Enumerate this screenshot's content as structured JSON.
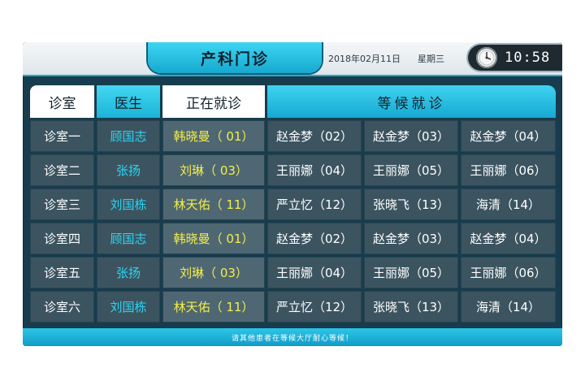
{
  "header": {
    "title": "产科门诊",
    "date": "2018年02月11日",
    "weekday": "星期三",
    "time": "10:58"
  },
  "table": {
    "columns": {
      "room": "诊室",
      "doctor": "医生",
      "current": "正在就诊",
      "waiting": "等候就诊"
    },
    "rows": [
      {
        "room": "诊室一",
        "doctor": "顾国志",
        "current": "韩晓曼（ 01）",
        "waiting": [
          "赵金梦（02）",
          "赵金梦（03）",
          "赵金梦（04）"
        ]
      },
      {
        "room": "诊室二",
        "doctor": "张扬",
        "current": "刘琳（ 03）",
        "waiting": [
          "王丽娜（04）",
          "王丽娜（05）",
          "王丽娜（06）"
        ]
      },
      {
        "room": "诊室三",
        "doctor": "刘国栋",
        "current": "林天佑（ 11）",
        "waiting": [
          "严立忆（12）",
          "张晓飞（13）",
          "海清（14）"
        ]
      },
      {
        "room": "诊室四",
        "doctor": "顾国志",
        "current": "韩晓曼（ 01）",
        "waiting": [
          "赵金梦（02）",
          "赵金梦（03）",
          "赵金梦（04）"
        ]
      },
      {
        "room": "诊室五",
        "doctor": "张扬",
        "current": "刘琳（ 03）",
        "waiting": [
          "王丽娜（04）",
          "王丽娜（05）",
          "王丽娜（06）"
        ]
      },
      {
        "room": "诊室六",
        "doctor": "刘国栋",
        "current": "林天佑（ 11）",
        "waiting": [
          "严立忆（12）",
          "张晓飞（13）",
          "海清（14）"
        ]
      }
    ]
  },
  "footer": {
    "notice": "请其他患者在等候大厅耐心等候！"
  },
  "colors": {
    "accent": "#1ab3d8",
    "panel": "#173c4e",
    "cell": "#3b5460",
    "doctor_text": "#2cd5f3",
    "current_text": "#f3ef4a"
  }
}
